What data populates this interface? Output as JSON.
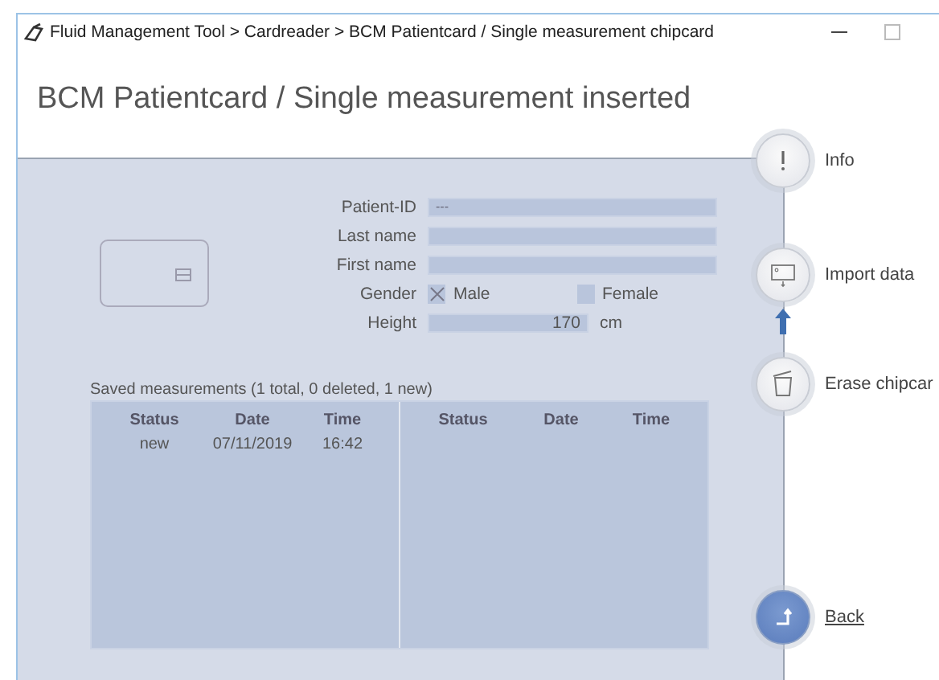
{
  "window": {
    "title": "Fluid Management Tool > Cardreader > BCM Patientcard / Single measurement chipcard"
  },
  "heading": "BCM Patientcard / Single measurement inserted",
  "form": {
    "fields": [
      {
        "label": "Patient-ID",
        "value": "---"
      },
      {
        "label": "Last name"
      },
      {
        "label": "First name"
      }
    ],
    "gender": {
      "label": "Gender",
      "options": [
        {
          "label": "Male",
          "checked": true
        },
        {
          "label": "Female",
          "checked": false
        }
      ]
    },
    "height": {
      "label": "Height",
      "value": "170",
      "unit": "cm"
    }
  },
  "measurements": {
    "title": "Saved measurements (1 total, 0 deleted, 1 new)",
    "left": {
      "columns": [
        "Status",
        "Date",
        "Time"
      ],
      "rows": [
        [
          "new",
          "07/11/2019",
          "16:42"
        ]
      ]
    },
    "right": {
      "columns": [
        "Status",
        "Date",
        "Time"
      ]
    }
  },
  "actions": [
    {
      "label": "Info",
      "kind": "info"
    },
    {
      "label": "Import data",
      "kind": "import"
    },
    {
      "label": "Erase chipcar",
      "kind": "erase"
    },
    {
      "label": "Back",
      "kind": "back"
    }
  ]
}
